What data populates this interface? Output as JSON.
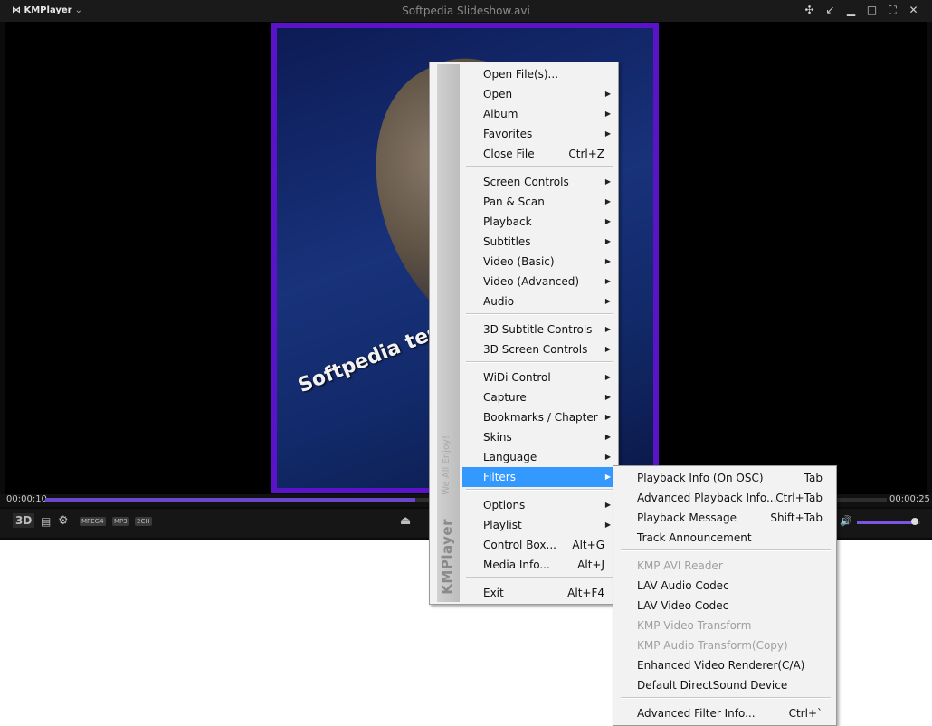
{
  "window": {
    "app_name": "KMPlayer",
    "title": "Softpedia Slideshow.avi",
    "buttons": [
      "pin-icon",
      "minimize-to-tray-icon",
      "minimize-icon",
      "maximize-icon",
      "fullscreen-icon",
      "close-icon"
    ]
  },
  "video": {
    "overlay_text": "Softpedia test",
    "frame_border_color": "#5a13c9"
  },
  "playback": {
    "elapsed": "00:00:10",
    "duration": "00:00:25",
    "progress_fraction": 0.44,
    "volume_fraction": 0.92
  },
  "controls": {
    "three_d": "3D",
    "badges": [
      "MPEG4",
      "MP3",
      "2CH"
    ]
  },
  "context_menu": {
    "brand": "KMPlayer",
    "slogan": "We All Enjoy!",
    "items": [
      {
        "label": "Open File(s)...",
        "shortcut": "",
        "submenu": false
      },
      {
        "label": "Open",
        "shortcut": "",
        "submenu": true
      },
      {
        "label": "Album",
        "shortcut": "",
        "submenu": true
      },
      {
        "label": "Favorites",
        "shortcut": "",
        "submenu": true
      },
      {
        "label": "Close File",
        "shortcut": "Ctrl+Z",
        "submenu": false
      },
      {
        "label": "Screen Controls",
        "shortcut": "",
        "submenu": true
      },
      {
        "label": "Pan & Scan",
        "shortcut": "",
        "submenu": true
      },
      {
        "label": "Playback",
        "shortcut": "",
        "submenu": true
      },
      {
        "label": "Subtitles",
        "shortcut": "",
        "submenu": true
      },
      {
        "label": "Video (Basic)",
        "shortcut": "",
        "submenu": true
      },
      {
        "label": "Video (Advanced)",
        "shortcut": "",
        "submenu": true
      },
      {
        "label": "Audio",
        "shortcut": "",
        "submenu": true
      },
      {
        "label": "3D Subtitle Controls",
        "shortcut": "",
        "submenu": true
      },
      {
        "label": "3D Screen Controls",
        "shortcut": "",
        "submenu": true
      },
      {
        "label": "WiDi Control",
        "shortcut": "",
        "submenu": true
      },
      {
        "label": "Capture",
        "shortcut": "",
        "submenu": true
      },
      {
        "label": "Bookmarks / Chapter",
        "shortcut": "",
        "submenu": true
      },
      {
        "label": "Skins",
        "shortcut": "",
        "submenu": true
      },
      {
        "label": "Language",
        "shortcut": "",
        "submenu": true
      },
      {
        "label": "Filters",
        "shortcut": "",
        "submenu": true,
        "highlighted": true
      },
      {
        "label": "Options",
        "shortcut": "",
        "submenu": true
      },
      {
        "label": "Playlist",
        "shortcut": "",
        "submenu": true
      },
      {
        "label": "Control Box...",
        "shortcut": "Alt+G",
        "submenu": false
      },
      {
        "label": "Media Info...",
        "shortcut": "Alt+J",
        "submenu": false
      },
      {
        "label": "Exit",
        "shortcut": "Alt+F4",
        "submenu": false
      }
    ]
  },
  "filters_submenu": {
    "items": [
      {
        "label": "Playback Info (On OSC)",
        "shortcut": "Tab",
        "disabled": false
      },
      {
        "label": "Advanced Playback Info...",
        "shortcut": "Ctrl+Tab",
        "disabled": false
      },
      {
        "label": "Playback Message",
        "shortcut": "Shift+Tab",
        "disabled": false
      },
      {
        "label": "Track Announcement",
        "shortcut": "",
        "disabled": false
      },
      {
        "label": "KMP AVI Reader",
        "shortcut": "",
        "disabled": true
      },
      {
        "label": "LAV Audio Codec",
        "shortcut": "",
        "disabled": false
      },
      {
        "label": "LAV Video Codec",
        "shortcut": "",
        "disabled": false
      },
      {
        "label": "KMP Video Transform",
        "shortcut": "",
        "disabled": true
      },
      {
        "label": "KMP Audio Transform(Copy)",
        "shortcut": "",
        "disabled": true
      },
      {
        "label": "Enhanced Video Renderer(C/A)",
        "shortcut": "",
        "disabled": false
      },
      {
        "label": "Default DirectSound Device",
        "shortcut": "",
        "disabled": false
      },
      {
        "label": "Advanced Filter Info...",
        "shortcut": "Ctrl+`",
        "disabled": false
      }
    ]
  }
}
